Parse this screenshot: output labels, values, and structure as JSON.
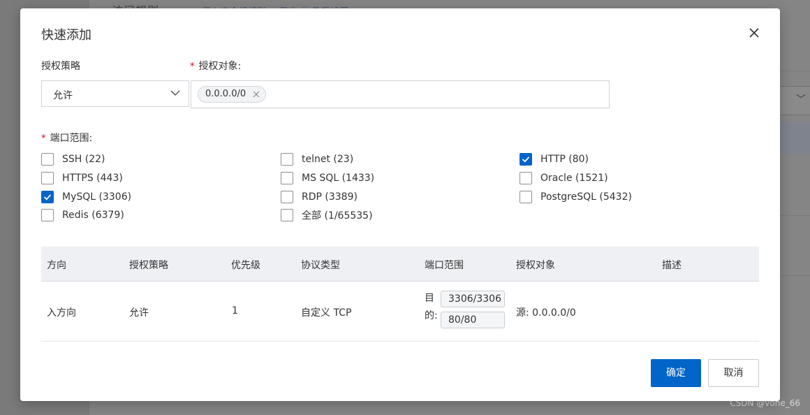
{
  "background": {
    "title": "访问规则",
    "links": "→ 导入安全组规则   → 导出   ⓘ 教我设置",
    "select_chevron": "﹀"
  },
  "dialog": {
    "title": "快速添加",
    "policy_label": "授权策略",
    "policy_value": "允许",
    "target_label": "授权对象:",
    "target_tag": "0.0.0.0/0",
    "port_range_label": "端口范围:",
    "ports": [
      {
        "label": "SSH (22)",
        "checked": false
      },
      {
        "label": "telnet (23)",
        "checked": false
      },
      {
        "label": "HTTP (80)",
        "checked": true
      },
      {
        "label": "HTTPS (443)",
        "checked": false
      },
      {
        "label": "MS SQL (1433)",
        "checked": false
      },
      {
        "label": "Oracle (1521)",
        "checked": false
      },
      {
        "label": "MySQL (3306)",
        "checked": true
      },
      {
        "label": "RDP (3389)",
        "checked": false
      },
      {
        "label": "PostgreSQL (5432)",
        "checked": false
      },
      {
        "label": "Redis (6379)",
        "checked": false
      },
      {
        "label": "全部 (1/65535)",
        "checked": false
      }
    ],
    "table": {
      "headers": [
        "方向",
        "授权策略",
        "优先级",
        "协议类型",
        "端口范围",
        "授权对象",
        "描述"
      ],
      "row": {
        "direction": "入方向",
        "policy": "允许",
        "priority": "1",
        "protocol": "自定义 TCP",
        "port_prefix_1": "目",
        "port_prefix_2": "的:",
        "port_values": [
          "3306/3306",
          "80/80"
        ],
        "target": "源: 0.0.0.0/0",
        "description": ""
      }
    },
    "ok_label": "确定",
    "cancel_label": "取消"
  },
  "watermark": "CSDN @vone_66",
  "colors": {
    "primary": "#0064c8",
    "required": "#d9001b"
  }
}
